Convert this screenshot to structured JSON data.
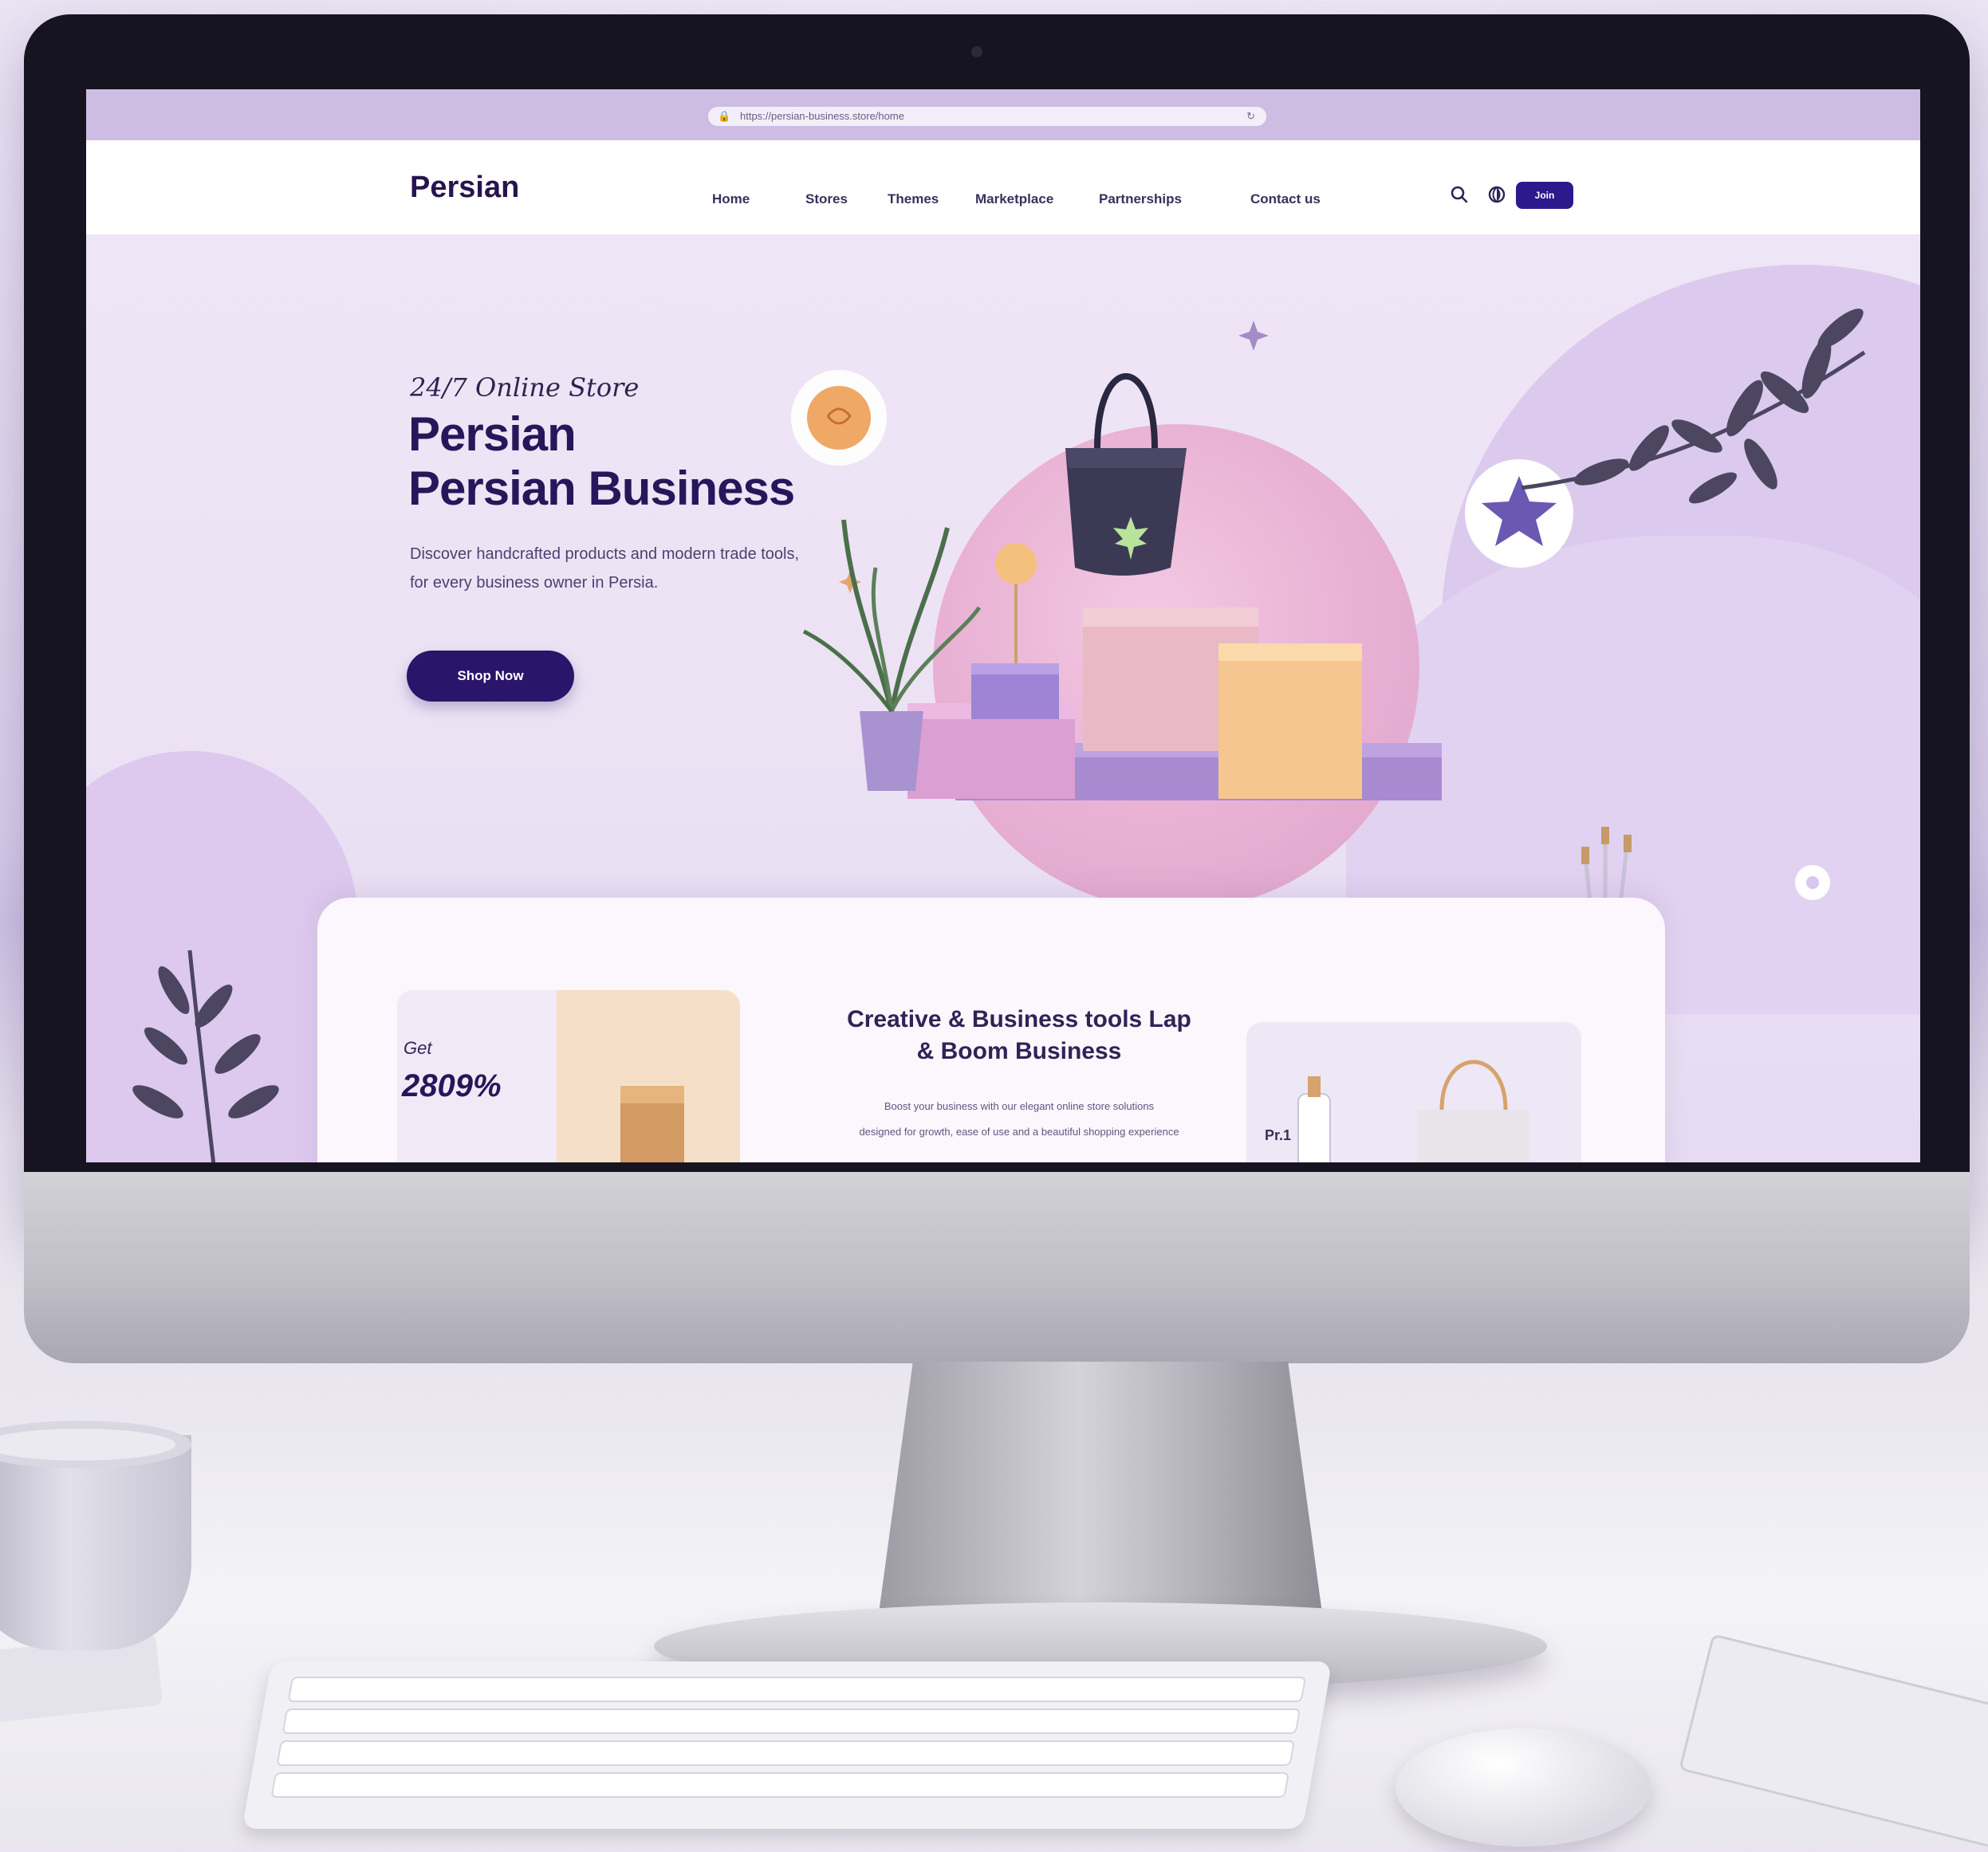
{
  "browser": {
    "url": "https://persian-business.store/home"
  },
  "nav": {
    "logo": "Persian",
    "items": [
      "Home",
      "Stores",
      "Themes",
      "Marketplace",
      "Partnerships",
      "Contact us"
    ],
    "cta_label": "Join"
  },
  "hero": {
    "eyebrow": "24/7 Online Store",
    "title_line1": "Persian",
    "title_line2": "Persian Business",
    "paragraph_line1": "Discover handcrafted products and modern trade tools,",
    "paragraph_line2": "for every business owner in Persia.",
    "button_label": "Shop Now"
  },
  "features": {
    "left_card_label": "Get",
    "left_card_value": "2809%",
    "center_title_line1": "Creative & Business tools Lap",
    "center_title_line2": "& Boom Business",
    "center_paragraph_line1": "Boost your business with our elegant online store solutions",
    "center_paragraph_line2": "designed for growth, ease of use and a beautiful shopping experience",
    "right_card_label": "Pr.1"
  },
  "colors": {
    "primary": "#2a156b",
    "accent_pink": "#e8b0d3",
    "background": "#efe6f6"
  }
}
